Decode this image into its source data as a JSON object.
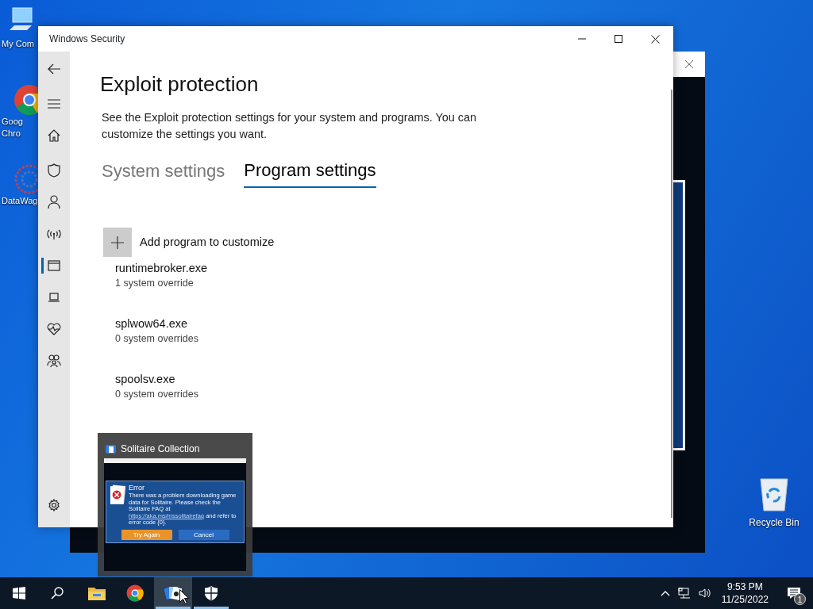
{
  "desktop_icons": [
    {
      "kind": "computer",
      "lines": [
        "My Com"
      ]
    },
    {
      "kind": "chrome",
      "lines": [
        "Goog",
        "Chro"
      ]
    },
    {
      "kind": "network",
      "lines": [
        "DataWag"
      ]
    }
  ],
  "security_window": {
    "title": "Windows Security",
    "nav": [
      {
        "kind": "back",
        "selected": false
      },
      {
        "kind": "menu",
        "selected": false
      },
      {
        "kind": "home",
        "selected": false
      },
      {
        "kind": "shield",
        "selected": false
      },
      {
        "kind": "person",
        "selected": false
      },
      {
        "kind": "wireless",
        "selected": false
      },
      {
        "kind": "app",
        "selected": true
      },
      {
        "kind": "laptop",
        "selected": false
      },
      {
        "kind": "heart",
        "selected": false
      },
      {
        "kind": "family",
        "selected": false
      },
      {
        "kind": "settings",
        "selected": false
      }
    ],
    "heading": "Exploit protection",
    "description": "See the Exploit protection settings for your system and programs.  You can customize the settings you want.",
    "tabs": [
      {
        "label": "System settings",
        "selected": false
      },
      {
        "label": "Program settings",
        "selected": true
      }
    ],
    "add_button": {
      "label": "Add program to customize"
    },
    "programs": [
      {
        "name": "runtimebroker.exe",
        "overrides": "1 system override"
      },
      {
        "name": "splwow64.exe",
        "overrides": "0 system overrides"
      },
      {
        "name": "spoolsv.exe",
        "overrides": "0 system overrides"
      }
    ]
  },
  "thumbnail": {
    "title": "Solitaire Collection",
    "dialog": {
      "title": "Error",
      "text_before": "There was a problem downloading game data for Solitaire. Please check the Solitaire FAQ at",
      "link": "https://aka.ms/mssolitairefaq",
      "text_after": "and refer to error code {0}.",
      "buttons": [
        {
          "label": "Try Again",
          "kind": "primary"
        },
        {
          "label": "Cancel",
          "kind": "secondary"
        }
      ]
    }
  },
  "recycle_bin": {
    "label": "Recycle Bin"
  },
  "taskbar": {
    "apps": [
      {
        "kind": "start",
        "running": false,
        "hovered": false
      },
      {
        "kind": "search",
        "running": false,
        "hovered": false
      },
      {
        "kind": "explorer",
        "running": false,
        "hovered": false
      },
      {
        "kind": "chrome",
        "running": false,
        "hovered": false
      },
      {
        "kind": "solitaire",
        "running": true,
        "hovered": true
      },
      {
        "kind": "security",
        "running": true,
        "hovered": false
      }
    ],
    "time": "9:53 PM",
    "date": "11/25/2022",
    "notifications": "1"
  }
}
